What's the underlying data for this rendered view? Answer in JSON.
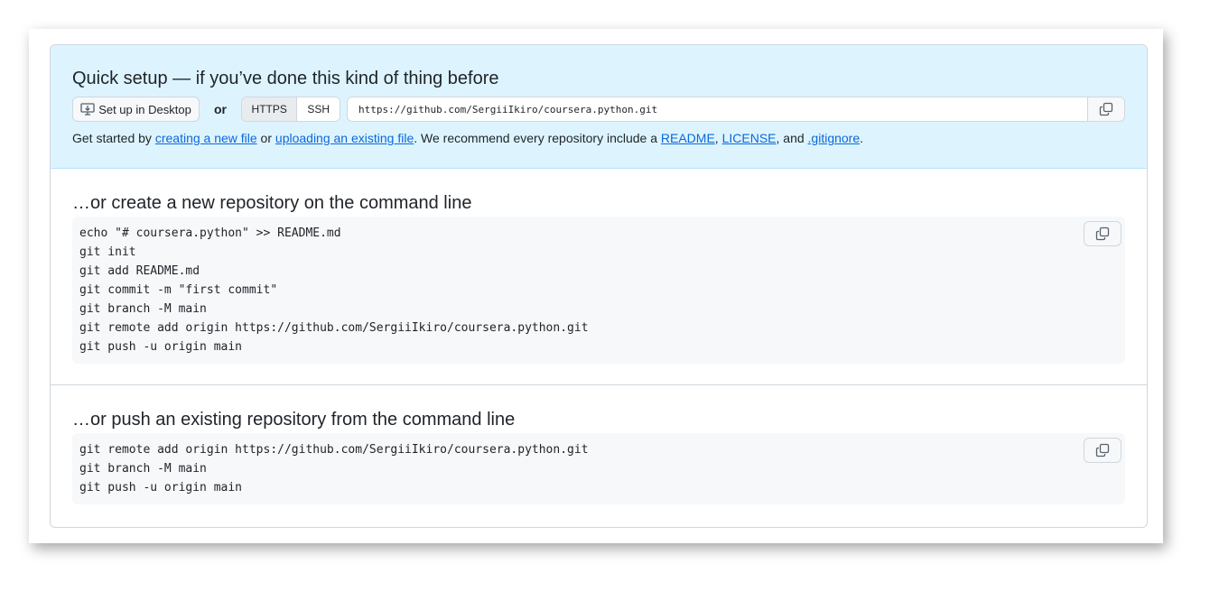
{
  "quick_setup": {
    "title": "Quick setup — if you’ve done this kind of thing before",
    "desktop_button": "Set up in Desktop",
    "or_label": "or",
    "protocols": [
      "HTTPS",
      "SSH"
    ],
    "selected_protocol": "HTTPS",
    "clone_url": "https://github.com/SergiiIkiro/coursera.python.git",
    "help": {
      "prefix": "Get started by ",
      "link_new_file": "creating a new file",
      "between": " or ",
      "link_upload": "uploading an existing file",
      "middle": ". We recommend every repository include a ",
      "link_readme": "README",
      "comma": ", ",
      "link_license": "LICENSE",
      "and": ", and ",
      "link_gitignore": ".gitignore",
      "suffix": "."
    }
  },
  "create_section": {
    "title": "…or create a new repository on the command line",
    "code": "echo \"# coursera.python\" >> README.md\ngit init\ngit add README.md\ngit commit -m \"first commit\"\ngit branch -M main\ngit remote add origin https://github.com/SergiiIkiro/coursera.python.git\ngit push -u origin main"
  },
  "push_section": {
    "title": "…or push an existing repository from the command line",
    "code": "git remote add origin https://github.com/SergiiIkiro/coursera.python.git\ngit branch -M main\ngit push -u origin main"
  },
  "icons": {
    "desktop": "desktop-download-icon",
    "copy": "copy-icon"
  },
  "colors": {
    "quick_bg": "#ddf4ff",
    "link": "#0969da",
    "code_bg": "#f6f8fa",
    "border": "#d0d7de"
  }
}
